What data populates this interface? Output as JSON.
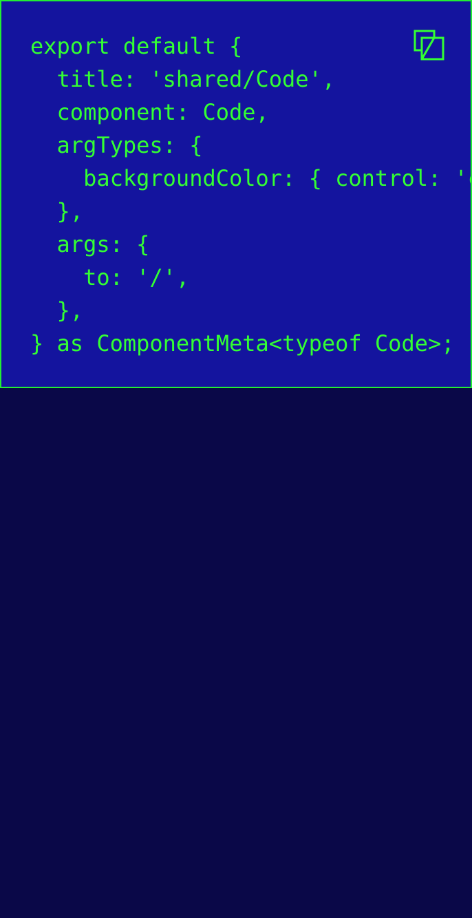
{
  "code_block": {
    "lines": [
      "export default {",
      "  title: 'shared/Code',",
      "  component: Code,",
      "  argTypes: {",
      "    backgroundColor: { control: 'color' },",
      "  },",
      "  args: {",
      "    to: '/',",
      "  },",
      "} as ComponentMeta<typeof Code>;"
    ],
    "copy_icon": "copy-icon"
  },
  "colors": {
    "page_background": "#0a0848",
    "code_background": "#14149e",
    "code_text": "#33ff33",
    "border": "#22ee33"
  }
}
